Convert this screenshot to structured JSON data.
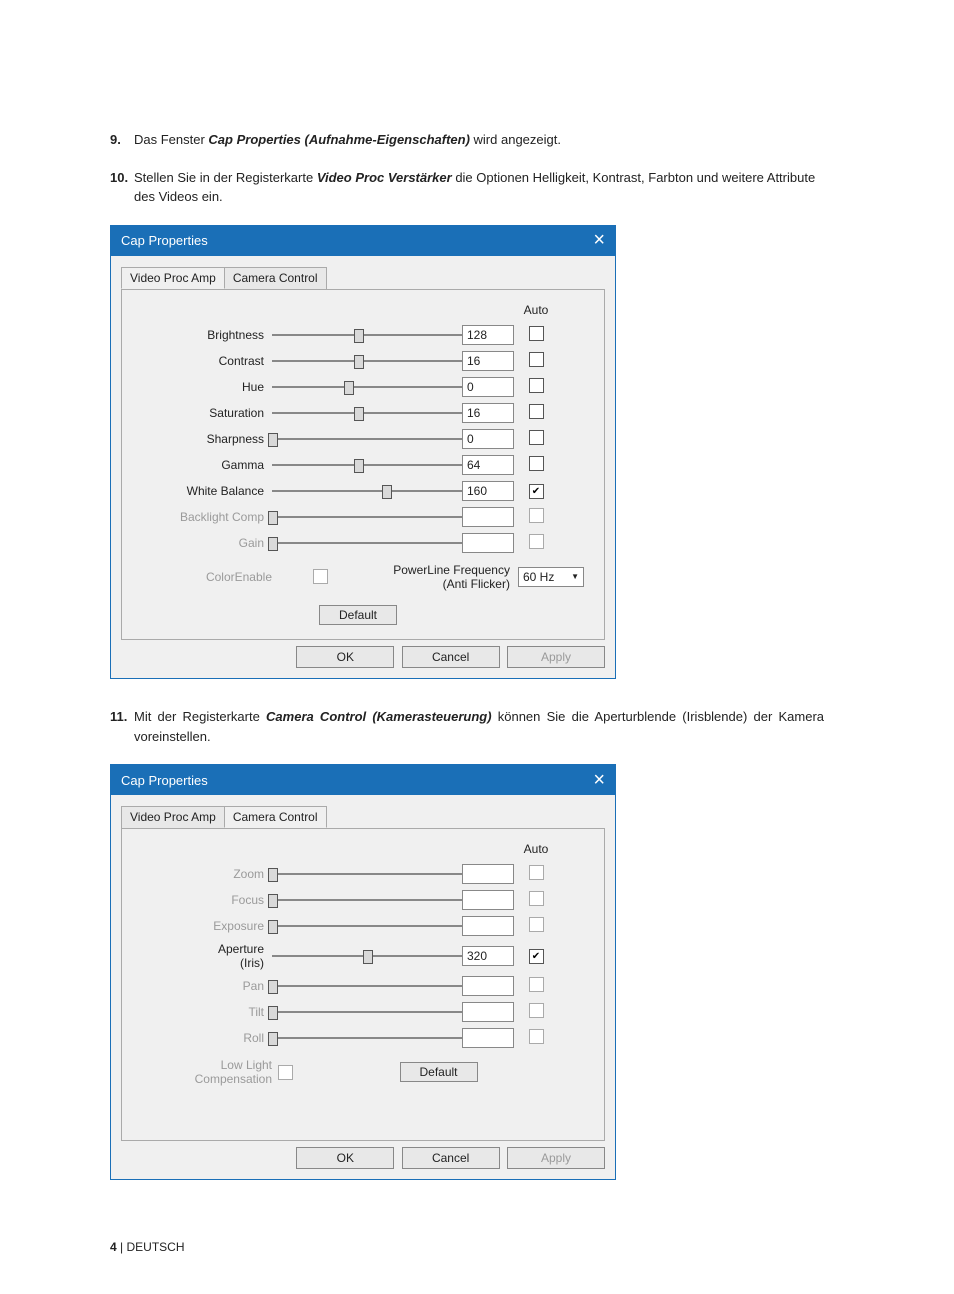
{
  "instructions": {
    "i9": {
      "num": "9.",
      "pre": "Das Fenster ",
      "bold": "Cap Properties (Aufnahme-Eigenschaften)",
      "post": " wird angezeigt."
    },
    "i10": {
      "num": "10.",
      "pre": "Stellen Sie in der Registerkarte ",
      "bold": "Video Proc Verstärker",
      "post": " die Optionen Helligkeit, Kontrast, Farbton und weitere Attribute des Videos ein."
    },
    "i11": {
      "num": "11.",
      "pre": "Mit der Registerkarte ",
      "bold": "Camera Control (Kamerasteuerung)",
      "post": " können Sie die Aperturblende (Irisblende) der Kamera voreinstellen."
    }
  },
  "dialog1": {
    "title": "Cap Properties",
    "tabs": {
      "t1": "Video Proc Amp",
      "t2": "Camera Control",
      "active": "t1"
    },
    "auto_header": "Auto",
    "sliders": [
      {
        "label": "Brightness",
        "value": "128",
        "pos": 0.45,
        "disabled": false,
        "checked": false
      },
      {
        "label": "Contrast",
        "value": "16",
        "pos": 0.45,
        "disabled": false,
        "checked": false
      },
      {
        "label": "Hue",
        "value": "0",
        "pos": 0.4,
        "disabled": false,
        "checked": false
      },
      {
        "label": "Saturation",
        "value": "16",
        "pos": 0.45,
        "disabled": false,
        "checked": false
      },
      {
        "label": "Sharpness",
        "value": "0",
        "pos": 0.0,
        "disabled": false,
        "checked": false
      },
      {
        "label": "Gamma",
        "value": "64",
        "pos": 0.45,
        "disabled": false,
        "checked": false
      },
      {
        "label": "White Balance",
        "value": "160",
        "pos": 0.6,
        "disabled": false,
        "checked": true
      },
      {
        "label": "Backlight Comp",
        "value": "",
        "pos": 0.0,
        "disabled": true,
        "checked": false
      },
      {
        "label": "Gain",
        "value": "",
        "pos": 0.0,
        "disabled": true,
        "checked": false
      }
    ],
    "colorenable_label": "ColorEnable",
    "powerline_label_l1": "PowerLine Frequency",
    "powerline_label_l2": "(Anti Flicker)",
    "powerline_value": "60 Hz",
    "default_label": "Default",
    "buttons": {
      "ok": "OK",
      "cancel": "Cancel",
      "apply": "Apply"
    }
  },
  "dialog2": {
    "title": "Cap Properties",
    "tabs": {
      "t1": "Video Proc Amp",
      "t2": "Camera Control",
      "active": "t2"
    },
    "auto_header": "Auto",
    "sliders": [
      {
        "label": "Zoom",
        "value": "",
        "pos": 0.0,
        "disabled": true,
        "checked": false
      },
      {
        "label": "Focus",
        "value": "",
        "pos": 0.0,
        "disabled": true,
        "checked": false
      },
      {
        "label": "Exposure",
        "value": "",
        "pos": 0.0,
        "disabled": true,
        "checked": false
      },
      {
        "label": "Aperture\n(Iris)",
        "value": "320",
        "pos": 0.5,
        "disabled": false,
        "checked": true
      },
      {
        "label": "Pan",
        "value": "",
        "pos": 0.0,
        "disabled": true,
        "checked": false
      },
      {
        "label": "Tilt",
        "value": "",
        "pos": 0.0,
        "disabled": true,
        "checked": false
      },
      {
        "label": "Roll",
        "value": "",
        "pos": 0.0,
        "disabled": true,
        "checked": false
      }
    ],
    "lowlight_label": "Low Light\nCompensation",
    "default_label": "Default",
    "buttons": {
      "ok": "OK",
      "cancel": "Cancel",
      "apply": "Apply"
    }
  },
  "footer": {
    "page": "4",
    "sep": " | ",
    "lang": "DEUTSCH"
  }
}
